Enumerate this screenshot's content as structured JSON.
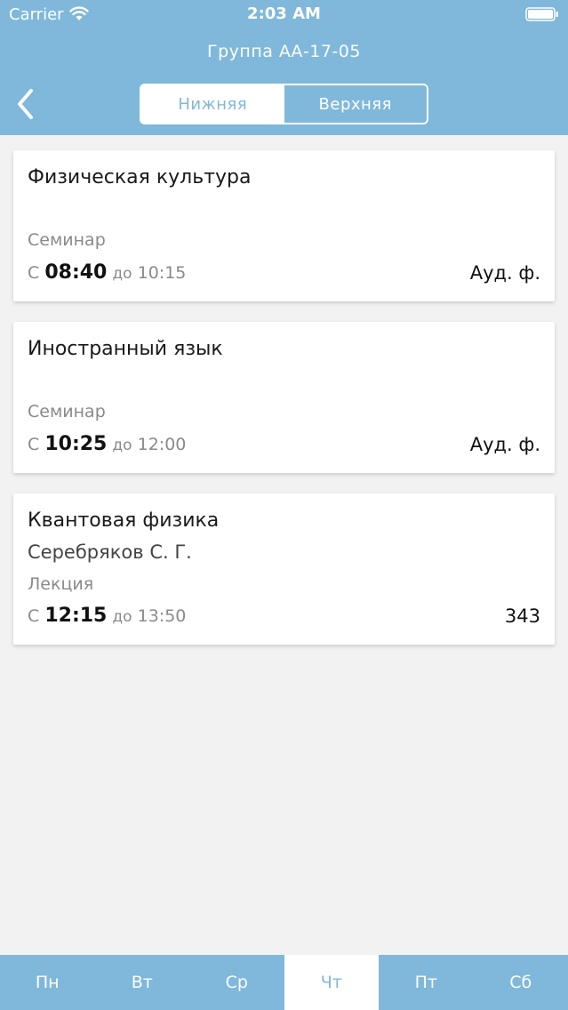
{
  "status_bar": {
    "carrier": "Carrier",
    "time": "2:03 AM"
  },
  "header": {
    "title": "Группа АА-17-05",
    "segments": [
      "Нижняя",
      "Верхняя"
    ],
    "selected_segment": "Нижняя"
  },
  "lessons": [
    {
      "title": "Физическая культура",
      "teacher": "",
      "type": "Семинар",
      "from_prefix": "С",
      "start": "08:40",
      "to_prefix": "до",
      "end": "10:15",
      "room": "Ауд. ф."
    },
    {
      "title": "Иностранный язык",
      "teacher": "",
      "type": "Семинар",
      "from_prefix": "С",
      "start": "10:25",
      "to_prefix": "до",
      "end": "12:00",
      "room": "Ауд. ф."
    },
    {
      "title": "Квантовая физика",
      "teacher": "Серебряков С. Г.",
      "type": "Лекция",
      "from_prefix": "С",
      "start": "12:15",
      "to_prefix": "до",
      "end": "13:50",
      "room": "343"
    }
  ],
  "tabs": [
    "Пн",
    "Вт",
    "Ср",
    "Чт",
    "Пт",
    "Сб"
  ],
  "active_tab": "Чт",
  "colors": {
    "accent": "#7fb8da",
    "background": "#f3f2f2"
  }
}
